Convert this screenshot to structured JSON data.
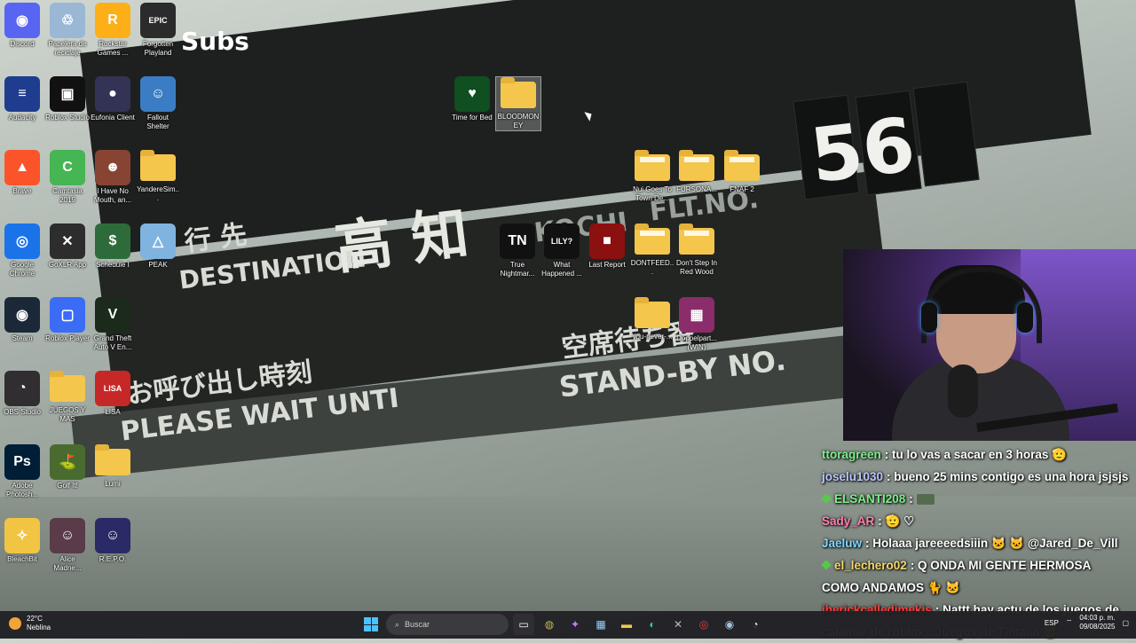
{
  "desktop_icons": [
    {
      "label": "Discord",
      "color": "#5865f2",
      "glyph": "◉"
    },
    {
      "label": "Papelera de reciclaje",
      "color": "#9ab7d6",
      "glyph": "♲"
    },
    {
      "label": "Rockstar Games ...",
      "color": "#fcaf17",
      "glyph": "R"
    },
    {
      "label": "Forgotten Playland",
      "color": "#2b2b2b",
      "glyph": "EPIC"
    },
    {
      "label": "Audacity",
      "color": "#1f3d8f",
      "glyph": "≡"
    },
    {
      "label": "Roblox Studio",
      "color": "#111111",
      "glyph": "▣"
    },
    {
      "label": "Eufonia Client",
      "color": "#333355",
      "glyph": "●"
    },
    {
      "label": "Fallout Shelter",
      "color": "#3b7dc4",
      "glyph": "☺"
    },
    {
      "label": "Brave",
      "color": "#fb542b",
      "glyph": "▲"
    },
    {
      "label": "Camtasia 2019",
      "color": "#46b553",
      "glyph": "C"
    },
    {
      "label": "I Have No Mouth, an...",
      "color": "#884433",
      "glyph": "☻"
    },
    {
      "label": "YandereSim...",
      "color": "#f4c64c",
      "glyph": ""
    },
    {
      "label": "Google Chrome",
      "color": "#1a73e8",
      "glyph": "◎"
    },
    {
      "label": "GoXLR App",
      "color": "#2d2d2d",
      "glyph": "✕"
    },
    {
      "label": "Schedule I",
      "color": "#2e6b3a",
      "glyph": "$"
    },
    {
      "label": "PEAK",
      "color": "#7fb3e0",
      "glyph": "△"
    },
    {
      "label": "Steam",
      "color": "#1b2838",
      "glyph": "◉"
    },
    {
      "label": "Roblox Player",
      "color": "#3b6cf6",
      "glyph": "▢"
    },
    {
      "label": "Grand Theft Auto V En...",
      "color": "#1b2a1b",
      "glyph": "V"
    },
    {
      "label": "OBS Studio",
      "color": "#302e31",
      "glyph": "◔"
    },
    {
      "label": "JUEGOS Y MAS",
      "color": "#f4c64c",
      "glyph": ""
    },
    {
      "label": "LISA",
      "color": "#c62828",
      "glyph": "LISA"
    },
    {
      "label": "Adobe Photosh...",
      "color": "#001e36",
      "glyph": "Ps"
    },
    {
      "label": "Golf It!",
      "color": "#4a6b2f",
      "glyph": "⛳"
    },
    {
      "label": "Lumi",
      "color": "#f4c64c",
      "glyph": ""
    },
    {
      "label": "BleachBit",
      "color": "#f2c443",
      "glyph": "✧"
    },
    {
      "label": "Alice Madne...",
      "color": "#5a3b4a",
      "glyph": "☺"
    },
    {
      "label": "R.E.P.O.",
      "color": "#2a2a66",
      "glyph": "☺"
    },
    {
      "label": "Time for Bed",
      "color": "#0f4f20",
      "glyph": "♥"
    },
    {
      "label": "BLOODMONEY",
      "color": "#f4c64c",
      "glyph": ""
    },
    {
      "label": "Nui Goes To Town De...",
      "color": "#f4c64c",
      "glyph": ""
    },
    {
      "label": "FURSONA...",
      "color": "#f4c64c",
      "glyph": ""
    },
    {
      "label": "FNAF 2",
      "color": "#f4c64c",
      "glyph": ""
    },
    {
      "label": "True Nightmar...",
      "color": "#111111",
      "glyph": "TN"
    },
    {
      "label": "What Happened ...",
      "color": "#111111",
      "glyph": "LILY?"
    },
    {
      "label": "Last Report",
      "color": "#8b1010",
      "glyph": "■"
    },
    {
      "label": "DONTFEED...",
      "color": "#f4c64c",
      "glyph": ""
    },
    {
      "label": "Don't Step In Red Wood",
      "color": "#f4c64c",
      "glyph": ""
    },
    {
      "label": "you-never-...",
      "color": "#f4c64c",
      "glyph": ""
    },
    {
      "label": "Doppelpart... (WIN)",
      "color": "#8b2d6a",
      "glyph": "▦"
    }
  ],
  "wallpaper": {
    "banner_text": "Subs",
    "dest_jp": "行 先",
    "dest_en": "DESTINATION",
    "city_jp": "高 知",
    "city_en": "KOCHI",
    "flt": "FLT.NO.",
    "flt_value": "56",
    "wait_jp": "お呼び出し時刻",
    "wait_en": "PLEASE WAIT UNTI",
    "standby_jp": "空席待ち番",
    "standby_en": "STAND-BY NO."
  },
  "chat": {
    "messages": [
      {
        "user": "ttoragreen",
        "color": "#7cf08a",
        "badge": false,
        "text": ": tu lo vas a sacar en 3 horas 🫡"
      },
      {
        "user": "joselu1030",
        "color": "#b9c6ff",
        "badge": false,
        "text": ": bueno 25 mins contigo es una hora jsjsjs"
      },
      {
        "user": "ELSANTI208",
        "color": "#7cf08a",
        "badge": true,
        "text": ":"
      },
      {
        "user": "Sady_AR",
        "color": "#ff7fb0",
        "badge": false,
        "text": ": 🫡 ♡"
      },
      {
        "user": "Jaeluw",
        "color": "#7fd7ff",
        "badge": false,
        "text": ": Holaaa jareeeedsiiin 🐱 🐱 @Jared_De_Vill"
      },
      {
        "user": "el_lechero02",
        "color": "#f7d86a",
        "badge": true,
        "text": ": Q ONDA MI GENTE HERMOSA"
      },
      {
        "user": "",
        "color": "#ffffff",
        "badge": false,
        "text": "COMO ANDAMOS 🐈 🐱"
      },
      {
        "user": "jherickcalledimekjs",
        "color": "#ff3b3b",
        "badge": false,
        "text": ": Nattt hay actu de los juegos de"
      },
      {
        "user": "",
        "color": "#ffffff",
        "badge": false,
        "text": "calamar de roblox : Juegos de Tintaaa 🐱"
      }
    ]
  },
  "taskbar": {
    "temperature": "22°C",
    "weather": "Neblina",
    "search_placeholder": "Buscar",
    "language": "ESP",
    "time": "04:03 p. m.",
    "date": "09/08/2025"
  }
}
